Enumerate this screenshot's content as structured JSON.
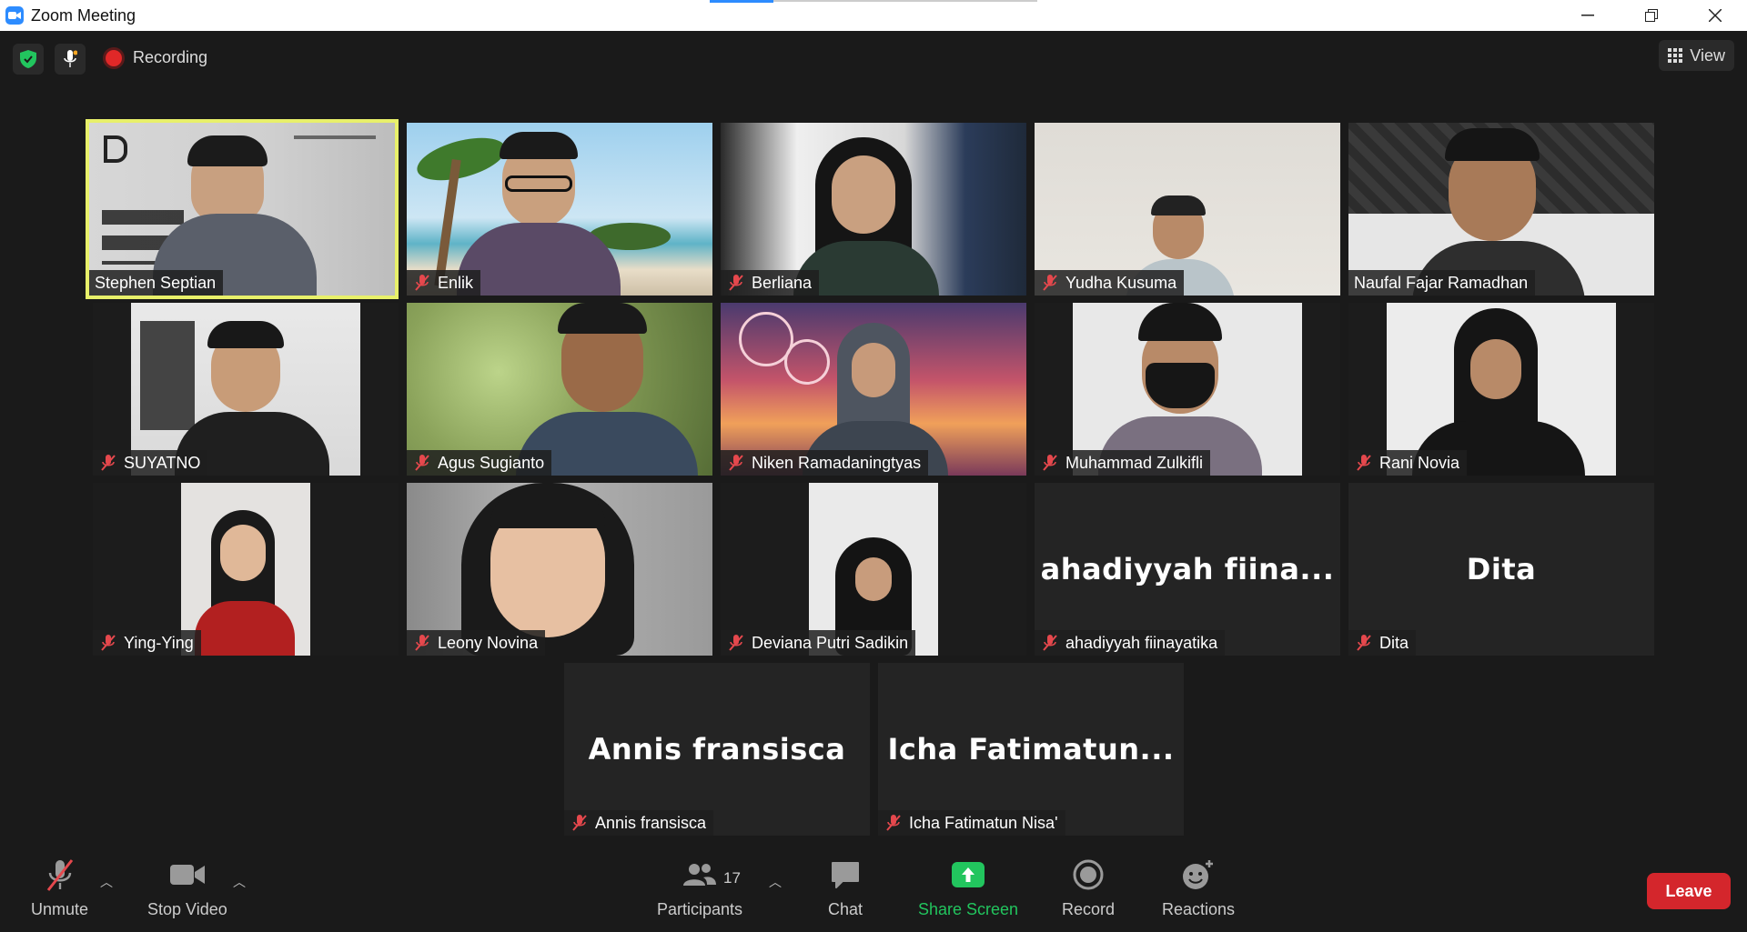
{
  "window": {
    "title": "Zoom Meeting",
    "controls": [
      "minimize",
      "restore",
      "close"
    ]
  },
  "topbar": {
    "recording_label": "Recording",
    "view_label": "View"
  },
  "participants": [
    {
      "name": "Stephen Septian",
      "video": true,
      "muted": false,
      "active_speaker": true
    },
    {
      "name": "Enlik",
      "video": true,
      "muted": true
    },
    {
      "name": "Berliana",
      "video": true,
      "muted": true
    },
    {
      "name": "Yudha Kusuma",
      "video": true,
      "muted": true
    },
    {
      "name": "Naufal Fajar Ramadhan",
      "video": true,
      "muted": false
    },
    {
      "name": "SUYATNO",
      "video": true,
      "muted": true
    },
    {
      "name": "Agus Sugianto",
      "video": true,
      "muted": true
    },
    {
      "name": "Niken Ramadaningtyas",
      "video": true,
      "muted": true
    },
    {
      "name": "Muhammad Zulkifli",
      "video": true,
      "muted": true
    },
    {
      "name": "Rani Novia",
      "video": true,
      "muted": true
    },
    {
      "name": "Ying-Ying",
      "video": true,
      "muted": true
    },
    {
      "name": "Leony Novina",
      "video": true,
      "muted": true
    },
    {
      "name": "Deviana Putri Sadikin",
      "video": true,
      "muted": true
    },
    {
      "name": "ahadiyyah fiinayatika",
      "video": false,
      "muted": true,
      "display_name": "ahadiyyah  fiina..."
    },
    {
      "name": "Dita",
      "video": false,
      "muted": true,
      "display_name": "Dita"
    },
    {
      "name": "Annis fransisca",
      "video": false,
      "muted": true,
      "display_name": "Annis fransisca"
    },
    {
      "name": "Icha Fatimatun Nisa'",
      "video": false,
      "muted": true,
      "display_name": "Icha  Fatimatun..."
    }
  ],
  "toolbar": {
    "unmute": "Unmute",
    "stop_video": "Stop Video",
    "participants": "Participants",
    "participants_count": "17",
    "chat": "Chat",
    "share_screen": "Share Screen",
    "record": "Record",
    "reactions": "Reactions",
    "leave": "Leave"
  },
  "colors": {
    "active_speaker": "#e8f06a",
    "share_green": "#22c55e",
    "leave_red": "#d4262c",
    "muted_red": "#e5484d"
  }
}
